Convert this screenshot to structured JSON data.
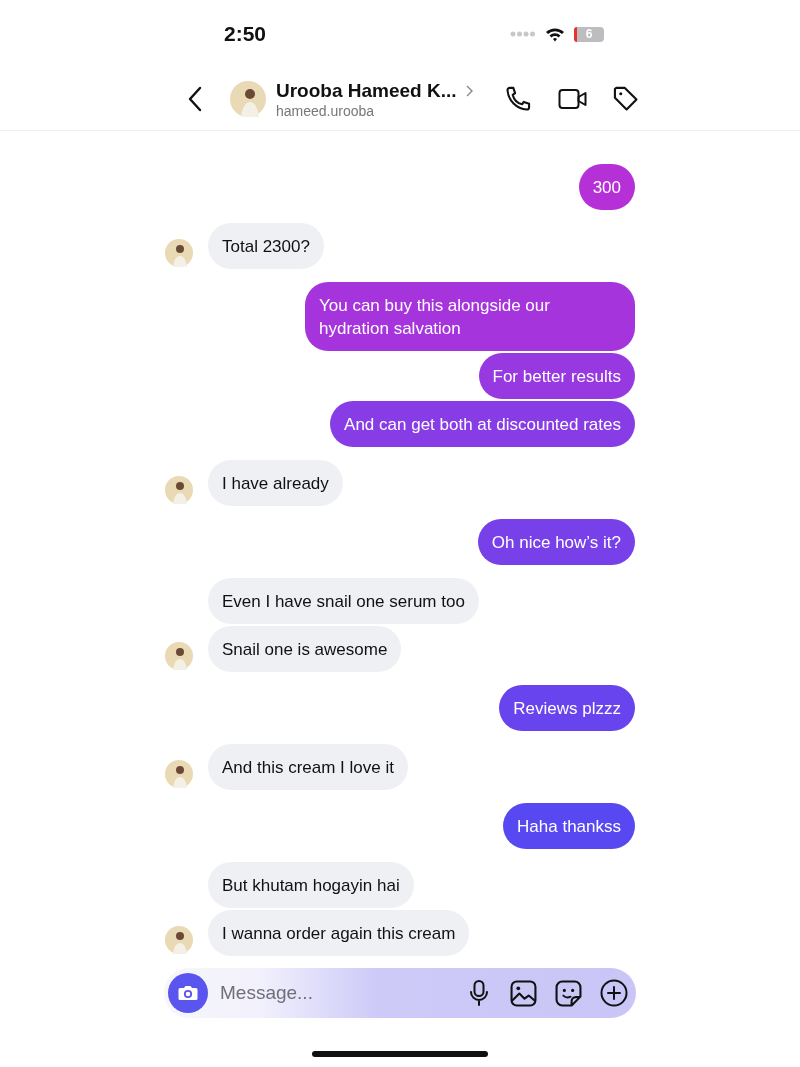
{
  "status_bar": {
    "time": "2:50",
    "battery": "6"
  },
  "header": {
    "name": "Urooba Hameed K...",
    "handle": "hameed.urooba"
  },
  "groups": [
    {
      "kind": "sent",
      "messages": [
        "300"
      ]
    },
    {
      "kind": "received",
      "messages": [
        "Total 2300?"
      ]
    },
    {
      "kind": "sent",
      "messages": [
        "You can buy this alongside our hydration salvation",
        "For better results",
        "And can get both at discounted rates"
      ]
    },
    {
      "kind": "received",
      "messages": [
        "I have already"
      ]
    },
    {
      "kind": "sent",
      "messages": [
        "Oh nice how’s it?"
      ]
    },
    {
      "kind": "received",
      "messages": [
        "Even I have snail one serum too",
        "Snail one is awesome"
      ]
    },
    {
      "kind": "sent",
      "messages": [
        "Reviews plzzz"
      ]
    },
    {
      "kind": "received",
      "messages": [
        "And this cream I love it"
      ]
    },
    {
      "kind": "sent",
      "messages": [
        "Haha thankss"
      ]
    },
    {
      "kind": "received",
      "messages": [
        "But khutam hogayin hai",
        "I wanna order again this cream"
      ]
    }
  ],
  "composer": {
    "placeholder": "Message..."
  }
}
